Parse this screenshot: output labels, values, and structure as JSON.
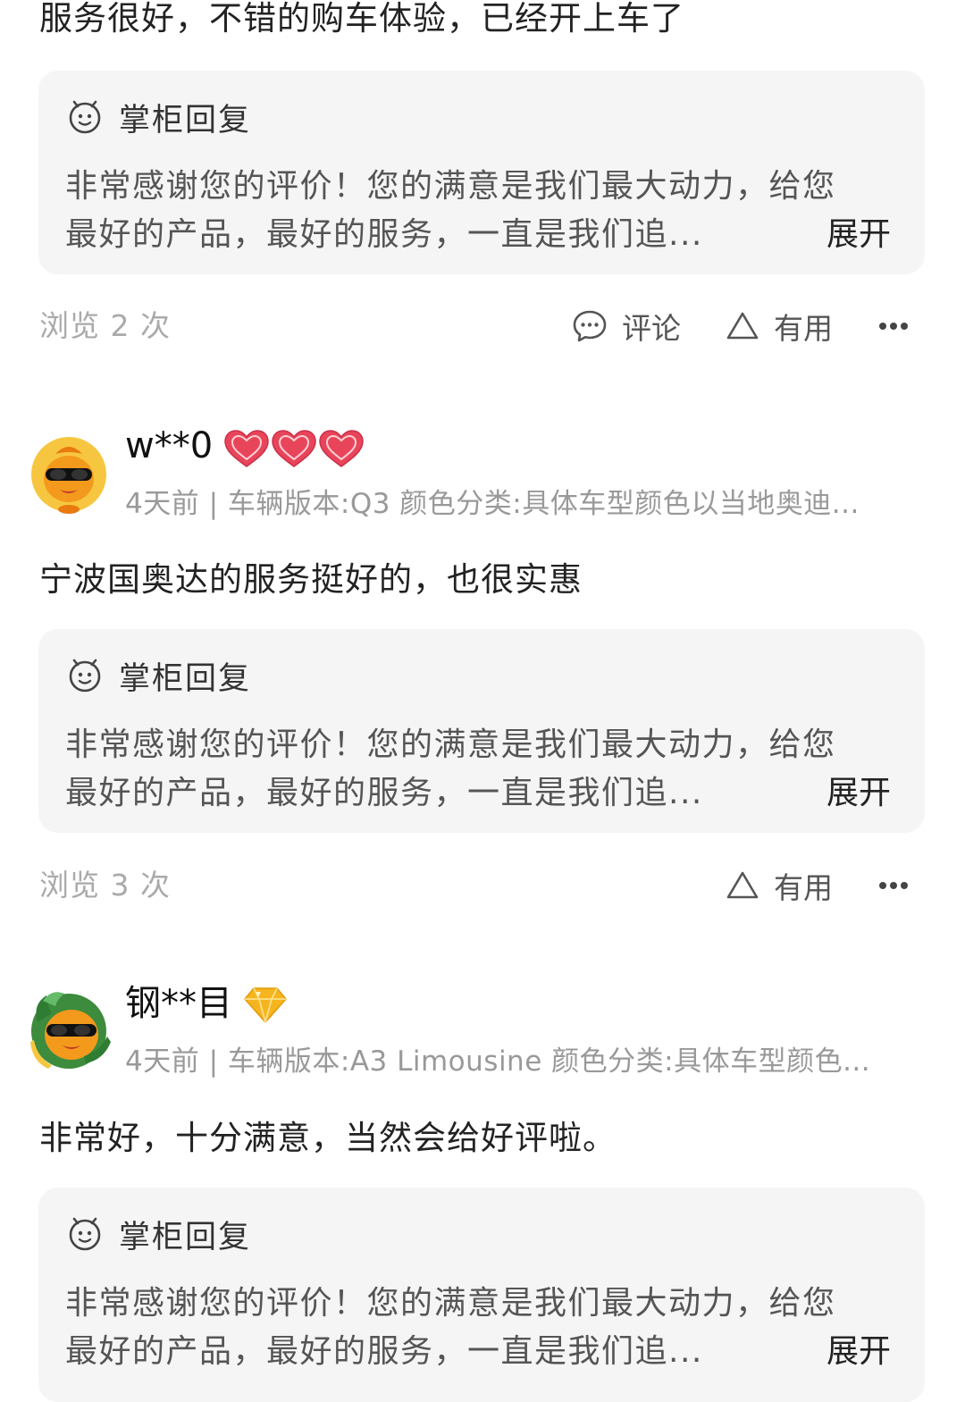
{
  "top_review": {
    "text": "服务很好，不错的购车体验，已经开上车了",
    "reply": {
      "title": "掌柜回复",
      "line1": "非常感谢您的评价！您的满意是我们最大动力，给您",
      "line2": "最好的产品，最好的服务，一直是我们追...",
      "expand": "展开"
    },
    "views": "浏览 2 次",
    "comment_label": "评论",
    "useful_label": "有用"
  },
  "review2": {
    "username": "w**0",
    "badge_icon": "heart-badge-icon",
    "badge_count": 3,
    "meta": "4天前 | 车辆版本:Q3 颜色分类:具体车型颜色以当地奥迪...",
    "text": "宁波国奥达的服务挺好的，也很实惠",
    "reply": {
      "title": "掌柜回复",
      "line1": "非常感谢您的评价！您的满意是我们最大动力，给您",
      "line2": "最好的产品，最好的服务，一直是我们追...",
      "expand": "展开"
    },
    "views": "浏览 3 次",
    "useful_label": "有用"
  },
  "review3": {
    "username": "钢**目",
    "badge_icon": "diamond-badge-icon",
    "meta": "4天前 | 车辆版本:A3 Limousine 颜色分类:具体车型颜色...",
    "text": "非常好，十分满意，当然会给好评啦。",
    "reply": {
      "title": "掌柜回复",
      "line1": "非常感谢您的评价！您的满意是我们最大动力，给您",
      "line2": "最好的产品，最好的服务，一直是我们追...",
      "expand": "展开"
    }
  },
  "colors": {
    "reply_bg": "#f5f5f5",
    "muted_text": "#999999",
    "heart_badge": "#e8455a",
    "diamond_badge": "#f6b51e",
    "avatar_orange": "#f39a1c"
  }
}
